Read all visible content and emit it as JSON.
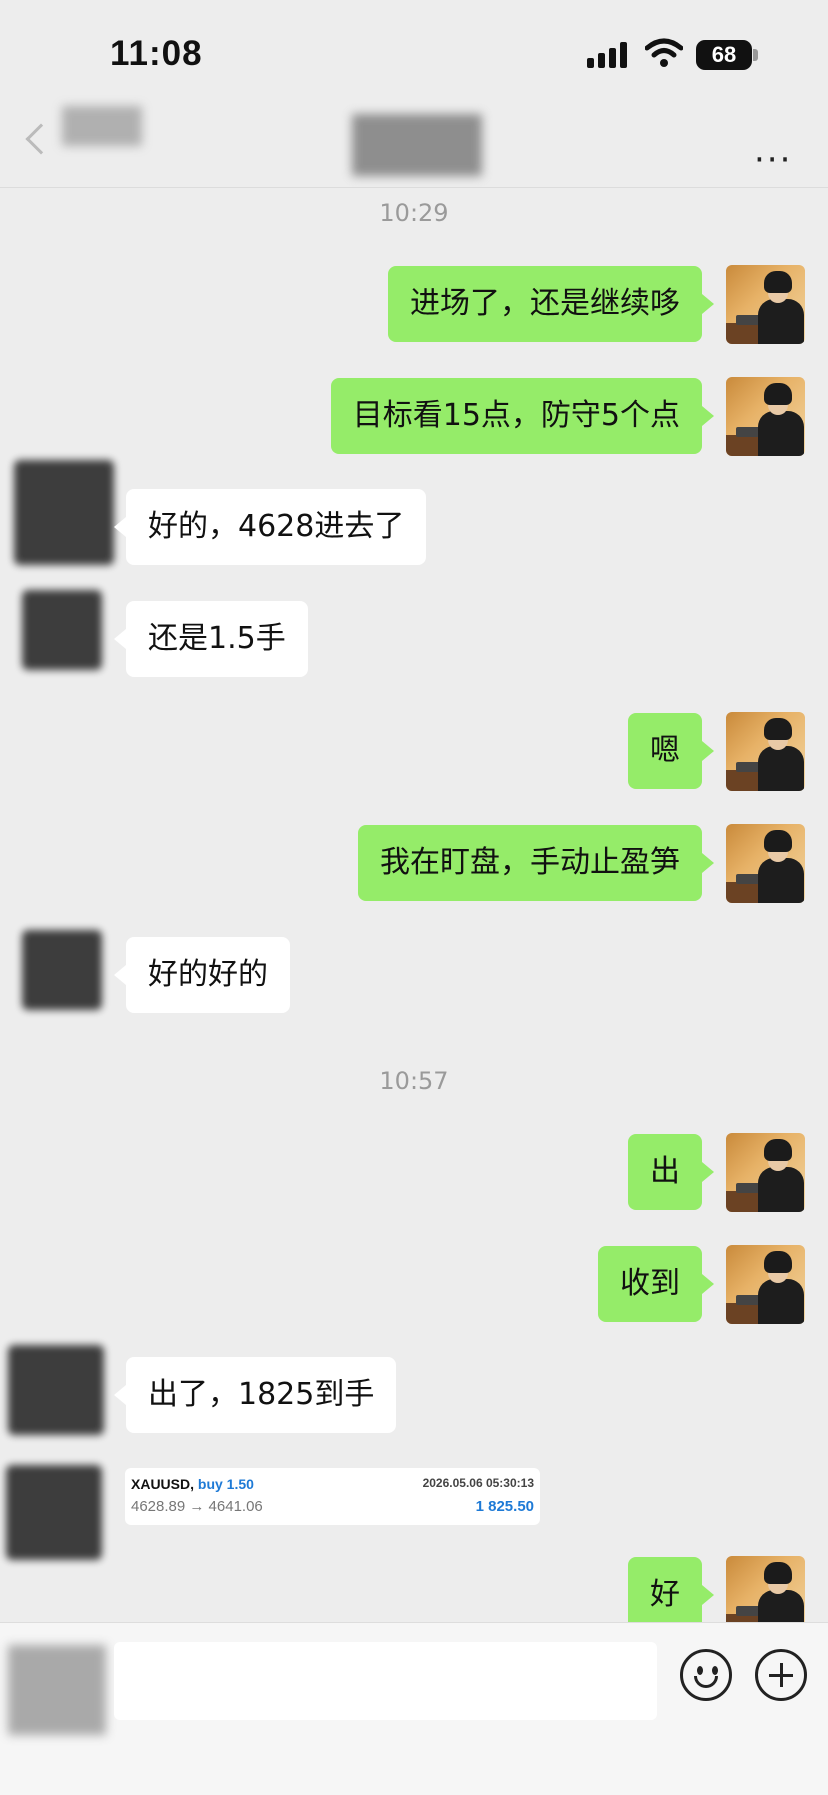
{
  "status_bar": {
    "time": "11:08",
    "battery": "68"
  },
  "nav": {
    "more": "···"
  },
  "time_separators": [
    "10:29",
    "10:57"
  ],
  "messages": [
    {
      "side": "out",
      "text": "进场了，还是继续哆"
    },
    {
      "side": "out",
      "text": "目标看15点，防守5个点"
    },
    {
      "side": "in",
      "text": "好的，4628进去了"
    },
    {
      "side": "in",
      "text": "还是1.5手"
    },
    {
      "side": "out",
      "text": "嗯"
    },
    {
      "side": "out",
      "text": "我在盯盘，手动止盈笋"
    },
    {
      "side": "in",
      "text": "好的好的"
    },
    {
      "side": "out",
      "text": "出"
    },
    {
      "side": "out",
      "text": "收到"
    },
    {
      "side": "in",
      "text": "出了，1825到手"
    },
    {
      "side": "out",
      "text": "好"
    }
  ],
  "trade_card": {
    "symbol": "XAUUSD,",
    "direction": "buy 1.50",
    "date": "2026.05.06 05:30:13",
    "prices": "4628.89 → 4641.06",
    "profit": "1 825.50"
  },
  "icons": {
    "emoji": "smiley-icon",
    "plus": "plus-circle-icon",
    "back": "back-chevron-icon",
    "more": "more-dots-icon"
  }
}
